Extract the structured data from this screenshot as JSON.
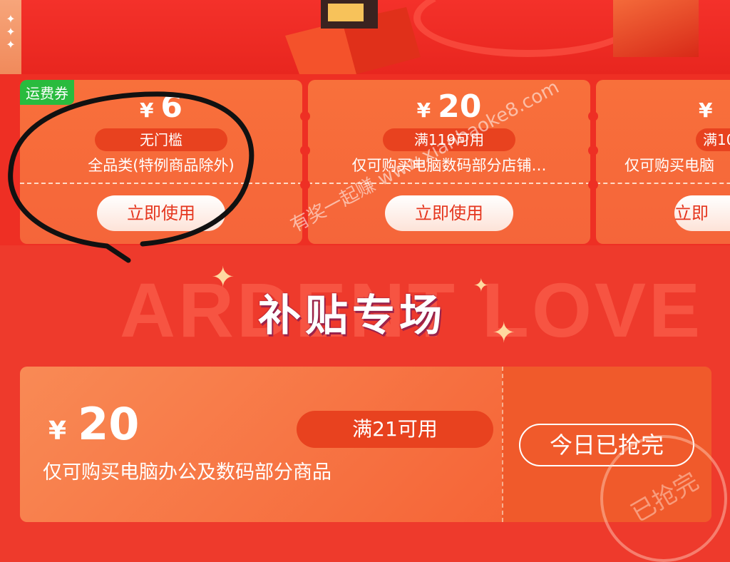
{
  "banner": {
    "sidebar_glyph": "✦\n✦\n✦",
    "accent": "#ee3a2c"
  },
  "coupons": [
    {
      "tag": "运费券",
      "amount": "6",
      "currency": "¥",
      "condition": "无门槛",
      "description": "全品类(特例商品除外)",
      "button": "立即使用"
    },
    {
      "tag": "",
      "amount": "20",
      "currency": "¥",
      "condition": "满119可用",
      "description": "仅可购买电脑数码部分店铺…",
      "button": "立即使用"
    },
    {
      "tag": "",
      "amount": "",
      "currency": "¥",
      "condition": "满10",
      "description": "仅可购买电脑",
      "button": "立即"
    }
  ],
  "section": {
    "title": "补贴专场",
    "bg_text": "ARDENT LOVE",
    "watermark": "有奖一起赚 www.xianbaoke8.com"
  },
  "featured_coupon": {
    "currency": "¥",
    "amount": "20",
    "condition": "满21可用",
    "description": "仅可购买电脑办公及数码部分商品",
    "button": "今日已抢完",
    "stamp": "已抢完"
  },
  "colors": {
    "primary_red": "#ee2f24",
    "coupon_orange": "#f5653a",
    "tag_green": "#29bb3e"
  }
}
